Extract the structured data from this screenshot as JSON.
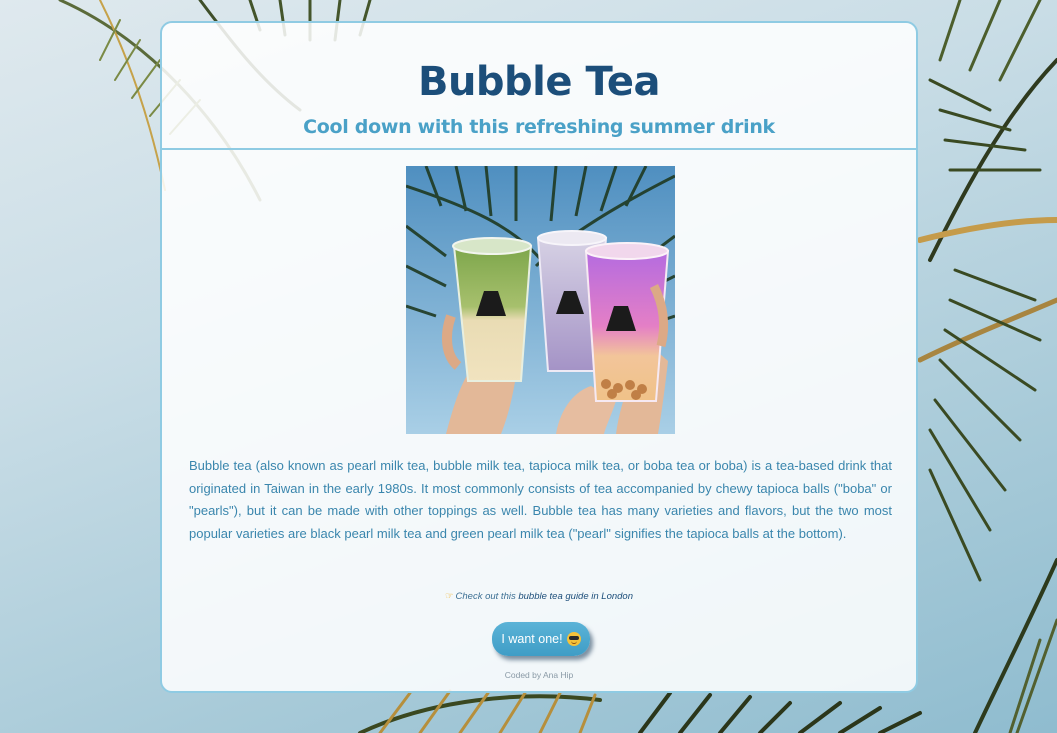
{
  "header": {
    "title": "Bubble Tea",
    "subtitle": "Cool down with this refreshing summer drink"
  },
  "photo": {
    "alt": "Three bubble tea cups held up against palm trees",
    "cup_colors": [
      "#b9c98a",
      "#b7a9cf",
      "#e47fc6"
    ]
  },
  "description": "Bubble tea (also known as pearl milk tea, bubble milk tea, tapioca milk tea, or boba tea or boba) is a tea-based drink that originated in Taiwan in the early 1980s. It most commonly consists of tea accompanied by chewy tapioca balls (\"boba\" or \"pearls\"), but it can be made with other toppings as well. Bubble tea has many varieties and flavors, but the two most popular varieties are black pearl milk tea and green pearl milk tea (\"pearl\" signifies the tapioca balls at the bottom).",
  "guide": {
    "hand_icon": "pointing-hand-icon",
    "prefix": "Check out this",
    "link_text": "bubble tea guide in London"
  },
  "cta": {
    "label": "I want one!",
    "icon": "sunglasses-face-icon"
  },
  "footer": {
    "credit": "Coded by Ana Hip"
  },
  "colors": {
    "title": "#1c4e7a",
    "subtitle": "#4aa1c7",
    "border": "#8fcbe3",
    "text": "#3a86ad",
    "button": "#4aa8d0"
  }
}
